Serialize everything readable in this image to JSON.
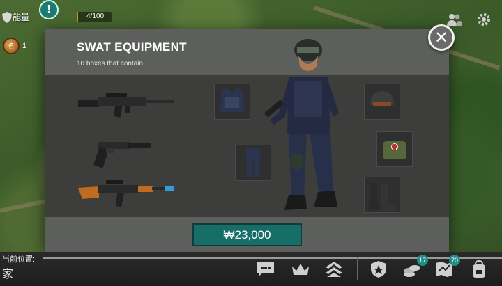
{
  "hud": {
    "energy_label": "能量",
    "energy_value": "4/100",
    "energy_fraction": 0.04,
    "alert_symbol": "!",
    "coin_count": "1"
  },
  "dialog": {
    "title": "SWAT EQUIPMENT",
    "subtitle": "10 boxes that contain:",
    "close_symbol": "✕",
    "price_label": "₩23,000"
  },
  "items": {
    "weapons": [
      "assault-rifle-icon",
      "pistol-with-silencer-icon",
      "ak-rifle-icon"
    ],
    "gear": [
      "body-armor-icon",
      "swat-pants-icon",
      "swat-helmet-icon",
      "medkit-bag-icon",
      "combat-boots-icon"
    ]
  },
  "bottom_bar": {
    "location_label": "当前位置:",
    "location_value": "家",
    "badges": {
      "coins": "17",
      "map": "70"
    }
  },
  "colors": {
    "accent": "#176e69",
    "dialog_bg": "#3d3d3c",
    "header_bg": "#5c5f5c"
  }
}
